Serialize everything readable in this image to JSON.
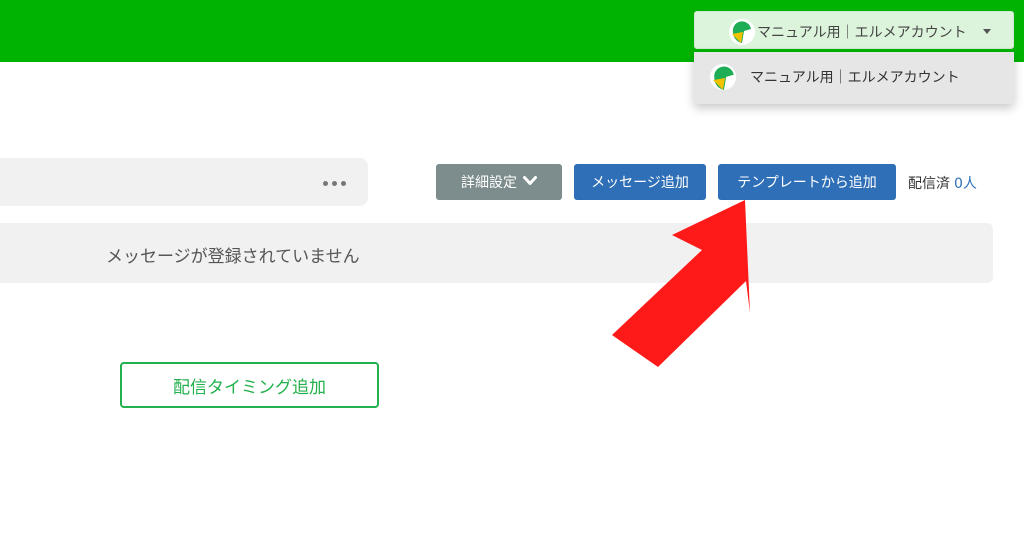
{
  "header": {
    "account_name": "マニュアル用｜エルメアカウント",
    "bg_color": "#00b300"
  },
  "dropdown": {
    "items": [
      {
        "label": "マニュアル用｜エルメアカウント"
      }
    ]
  },
  "toolbar": {
    "detail_label": "詳細設定",
    "add_message_label": "メッセージ追加",
    "add_template_label": "テンプレートから追加",
    "sent_label": "配信済",
    "sent_count": "0人"
  },
  "main": {
    "empty_message": "メッセージが登録されていません",
    "add_timing_label": "配信タイミング追加"
  },
  "icons": {
    "account": "account-avatar-icon",
    "more": "more-dots-icon",
    "detail_chevron": "chevron-down-icon",
    "caret": "caret-down-icon",
    "annotation": "red-pointer-arrow-icon"
  },
  "colors": {
    "primary_button": "#2e6fb7",
    "secondary_button": "#7d8c8c",
    "accent_green": "#22b14c",
    "annotation_red": "#ff1a1a"
  }
}
